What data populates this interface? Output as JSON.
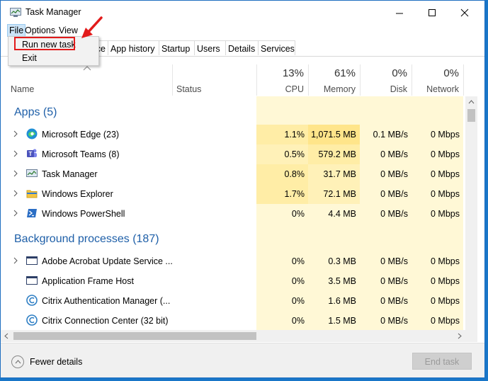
{
  "window": {
    "title": "Task Manager"
  },
  "menu": {
    "file": "File",
    "options": "Options",
    "view": "View"
  },
  "file_menu": {
    "run_new_task": "Run new task",
    "exit": "Exit"
  },
  "tabs": {
    "hidden_partial": "ce",
    "app_history": "App history",
    "startup": "Startup",
    "users": "Users",
    "details": "Details",
    "services": "Services"
  },
  "columns": {
    "name": "Name",
    "status": "Status",
    "cpu": {
      "pct": "13%",
      "label": "CPU"
    },
    "memory": {
      "pct": "61%",
      "label": "Memory"
    },
    "disk": {
      "pct": "0%",
      "label": "Disk"
    },
    "network": {
      "pct": "0%",
      "label": "Network"
    }
  },
  "groups": {
    "apps": "Apps (5)",
    "background": "Background processes (187)"
  },
  "apps": [
    {
      "name": "Microsoft Edge (23)",
      "cpu": "1.1%",
      "memory": "1,071.5 MB",
      "disk": "0.1 MB/s",
      "network": "0 Mbps"
    },
    {
      "name": "Microsoft Teams (8)",
      "cpu": "0.5%",
      "memory": "579.2 MB",
      "disk": "0 MB/s",
      "network": "0 Mbps"
    },
    {
      "name": "Task Manager",
      "cpu": "0.8%",
      "memory": "31.7 MB",
      "disk": "0 MB/s",
      "network": "0 Mbps"
    },
    {
      "name": "Windows Explorer",
      "cpu": "1.7%",
      "memory": "72.1 MB",
      "disk": "0 MB/s",
      "network": "0 Mbps"
    },
    {
      "name": "Windows PowerShell",
      "cpu": "0%",
      "memory": "4.4 MB",
      "disk": "0 MB/s",
      "network": "0 Mbps"
    }
  ],
  "background": [
    {
      "name": "Adobe Acrobat Update Service ...",
      "cpu": "0%",
      "memory": "0.3 MB",
      "disk": "0 MB/s",
      "network": "0 Mbps"
    },
    {
      "name": "Application Frame Host",
      "cpu": "0%",
      "memory": "3.5 MB",
      "disk": "0 MB/s",
      "network": "0 Mbps"
    },
    {
      "name": "Citrix Authentication Manager (...",
      "cpu": "0%",
      "memory": "1.6 MB",
      "disk": "0 MB/s",
      "network": "0 Mbps"
    },
    {
      "name": "Citrix Connection Center (32 bit)",
      "cpu": "0%",
      "memory": "1.5 MB",
      "disk": "0 MB/s",
      "network": "0 Mbps"
    }
  ],
  "footer": {
    "fewer_details": "Fewer details",
    "end_task": "End task"
  },
  "colors": {
    "accent_highlight": "#e21b1b",
    "group_title": "#1e5fa8",
    "cpu_heat_low": "#fff4c4",
    "cpu_heat_mid": "#ffec9e"
  }
}
